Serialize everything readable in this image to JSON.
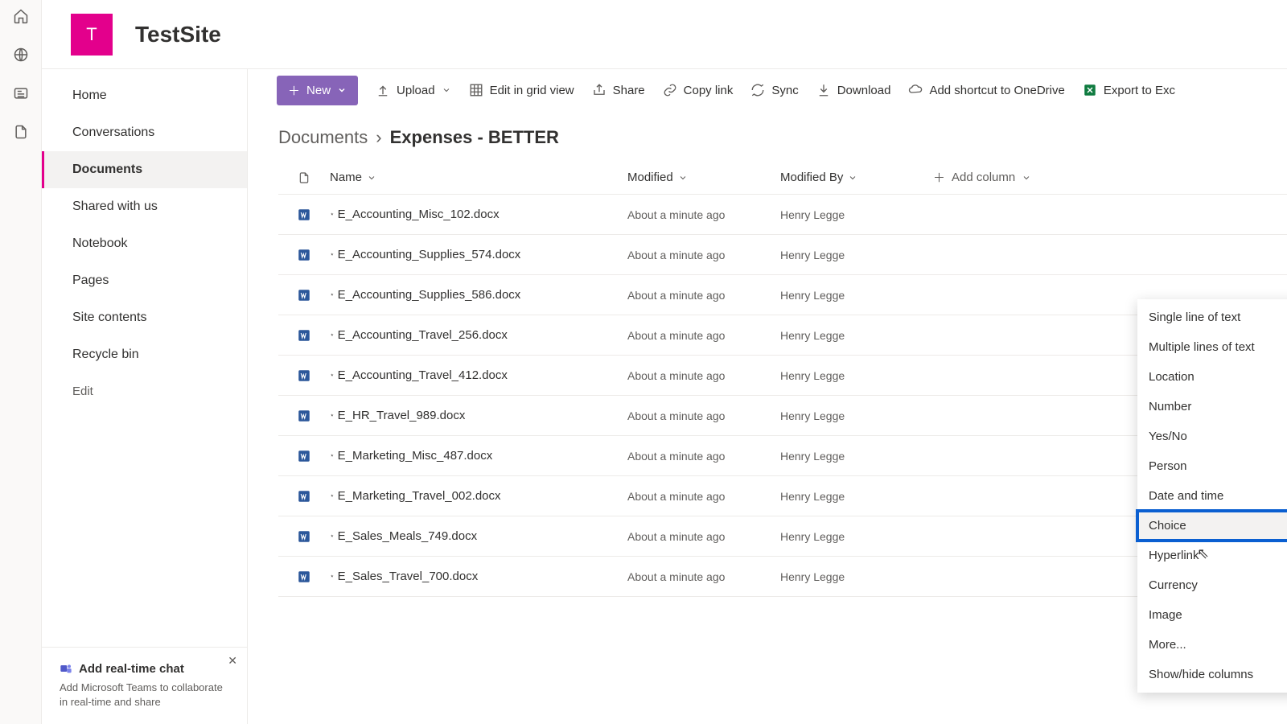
{
  "site": {
    "tile_letter": "T",
    "title": "TestSite"
  },
  "rail": [
    "home",
    "globe",
    "news",
    "file"
  ],
  "nav": {
    "items": [
      {
        "label": "Home"
      },
      {
        "label": "Conversations"
      },
      {
        "label": "Documents",
        "active": true
      },
      {
        "label": "Shared with us"
      },
      {
        "label": "Notebook"
      },
      {
        "label": "Pages"
      },
      {
        "label": "Site contents"
      },
      {
        "label": "Recycle bin"
      }
    ],
    "edit_label": "Edit"
  },
  "chat_card": {
    "title": "Add real-time chat",
    "desc": "Add Microsoft Teams to collaborate in real-time and share"
  },
  "toolbar": {
    "new": "New",
    "upload": "Upload",
    "grid": "Edit in grid view",
    "share": "Share",
    "copy": "Copy link",
    "sync": "Sync",
    "download": "Download",
    "shortcut": "Add shortcut to OneDrive",
    "export": "Export to Exc"
  },
  "breadcrumb": {
    "parent": "Documents",
    "current": "Expenses - BETTER"
  },
  "columns": {
    "name": "Name",
    "modified": "Modified",
    "by": "Modified By",
    "add": "Add column"
  },
  "rows": [
    {
      "name": "E_Accounting_Misc_102.docx",
      "modified": "About a minute ago",
      "by": "Henry Legge"
    },
    {
      "name": "E_Accounting_Supplies_574.docx",
      "modified": "About a minute ago",
      "by": "Henry Legge"
    },
    {
      "name": "E_Accounting_Supplies_586.docx",
      "modified": "About a minute ago",
      "by": "Henry Legge"
    },
    {
      "name": "E_Accounting_Travel_256.docx",
      "modified": "About a minute ago",
      "by": "Henry Legge"
    },
    {
      "name": "E_Accounting_Travel_412.docx",
      "modified": "About a minute ago",
      "by": "Henry Legge"
    },
    {
      "name": "E_HR_Travel_989.docx",
      "modified": "About a minute ago",
      "by": "Henry Legge"
    },
    {
      "name": "E_Marketing_Misc_487.docx",
      "modified": "About a minute ago",
      "by": "Henry Legge"
    },
    {
      "name": "E_Marketing_Travel_002.docx",
      "modified": "About a minute ago",
      "by": "Henry Legge"
    },
    {
      "name": "E_Sales_Meals_749.docx",
      "modified": "About a minute ago",
      "by": "Henry Legge"
    },
    {
      "name": "E_Sales_Travel_700.docx",
      "modified": "About a minute ago",
      "by": "Henry Legge"
    }
  ],
  "dropdown": {
    "items": [
      "Single line of text",
      "Multiple lines of text",
      "Location",
      "Number",
      "Yes/No",
      "Person",
      "Date and time",
      "Choice",
      "Hyperlink",
      "Currency",
      "Image",
      "More...",
      "Show/hide columns"
    ],
    "selected_index": 7
  }
}
